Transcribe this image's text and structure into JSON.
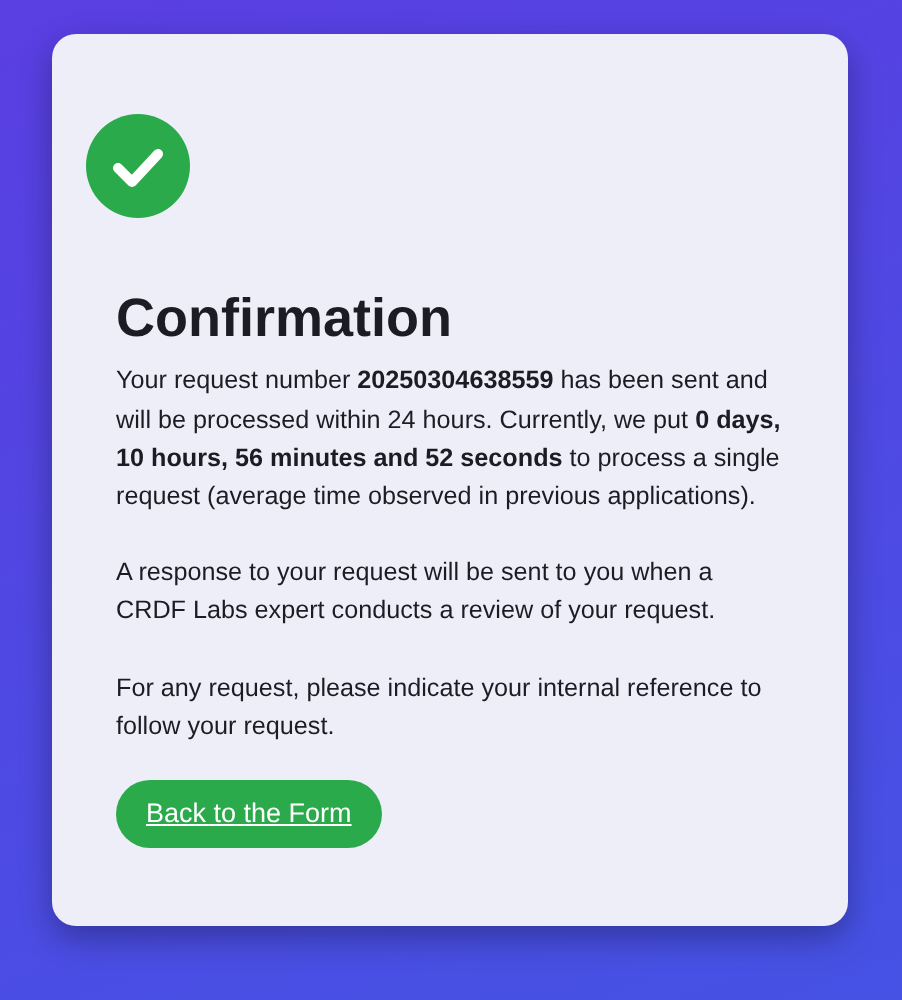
{
  "confirmation": {
    "success": true,
    "title": "Confirmation",
    "paragraphs": [
      "Your request number **20250304638559** has been sent and will be processed within 24 hours. Currently, we put **0 days, 10 hours, 56 minutes and 52 seconds** to process a single request (average time observed in previous applications).",
      "A response to your request will be sent to you when a CRDF Labs expert conducts a review of your request.",
      "For any request, please indicate your internal reference to follow your request."
    ],
    "button": "Back to the Form"
  }
}
